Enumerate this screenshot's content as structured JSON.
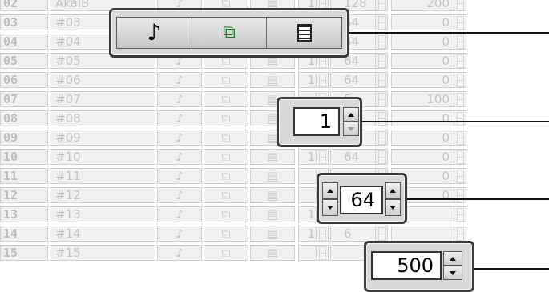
{
  "rows": [
    {
      "num": "02",
      "name": "AkaiB",
      "ch": "1",
      "vel": "128",
      "val": "200"
    },
    {
      "num": "03",
      "name": "#03",
      "ch": "",
      "vel": "64",
      "val": "0"
    },
    {
      "num": "04",
      "name": "#04",
      "ch": "",
      "vel": "64",
      "val": "0"
    },
    {
      "num": "05",
      "name": "#05",
      "ch": "1",
      "vel": "64",
      "val": "0"
    },
    {
      "num": "06",
      "name": "#06",
      "ch": "1",
      "vel": "64",
      "val": "0"
    },
    {
      "num": "07",
      "name": "#07",
      "ch": "",
      "vel": "5",
      "val": "100"
    },
    {
      "num": "08",
      "name": "#08",
      "ch": "",
      "vel": "",
      "val": "0"
    },
    {
      "num": "09",
      "name": "#09",
      "ch": "1",
      "vel": "64",
      "val": "0"
    },
    {
      "num": "10",
      "name": "#10",
      "ch": "1",
      "vel": "64",
      "val": "0"
    },
    {
      "num": "11",
      "name": "#11",
      "ch": "",
      "vel": "",
      "val": "0"
    },
    {
      "num": "12",
      "name": "#12",
      "ch": "",
      "vel": "64",
      "val": "0"
    },
    {
      "num": "13",
      "name": "#13",
      "ch": "1",
      "vel": "6",
      "val": ""
    },
    {
      "num": "14",
      "name": "#14",
      "ch": "1",
      "vel": "6",
      "val": ""
    },
    {
      "num": "15",
      "name": "#15",
      "ch": "",
      "vel": "",
      "val": ""
    }
  ],
  "icons": {
    "note": "music-note-icon",
    "copy": "copy-paste-icon",
    "calc": "calculator-icon"
  },
  "callouts": {
    "channel_value": "1",
    "velocity_value": "64",
    "value_value": "500"
  }
}
